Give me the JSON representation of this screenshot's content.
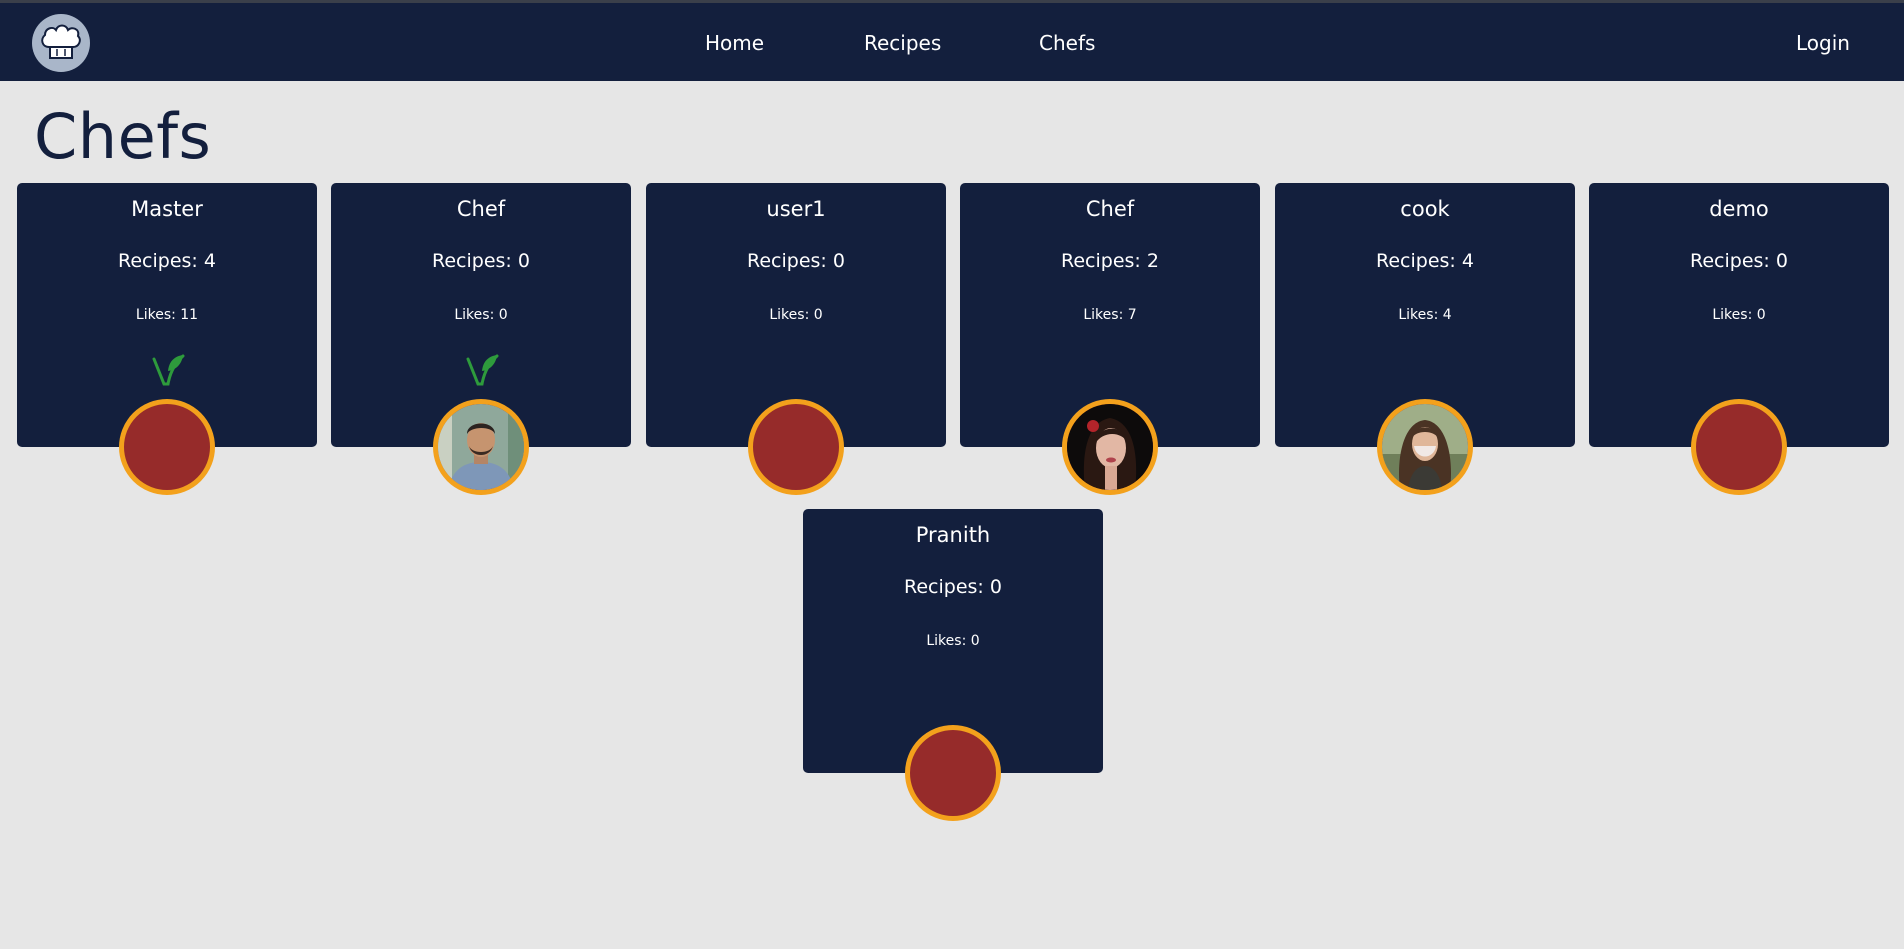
{
  "nav": {
    "logo_icon": "chef-hat-icon",
    "links": [
      "Home",
      "Recipes",
      "Chefs"
    ],
    "login": "Login"
  },
  "page": {
    "title": "Chefs"
  },
  "colors": {
    "navy": "#131f3d",
    "background": "#e6e6e6",
    "avatar_placeholder": "#962b2a",
    "avatar_border": "#f3a11c",
    "veg_icon": "#2e9b3c"
  },
  "chefs": [
    {
      "name": "Master",
      "recipes": "Recipes: 4",
      "likes": "Likes: 11",
      "vegetarian": true,
      "avatar": "placeholder"
    },
    {
      "name": "Chef",
      "recipes": "Recipes: 0",
      "likes": "Likes: 0",
      "vegetarian": true,
      "avatar": "photo-man"
    },
    {
      "name": "user1",
      "recipes": "Recipes: 0",
      "likes": "Likes: 0",
      "vegetarian": false,
      "avatar": "placeholder"
    },
    {
      "name": "Chef",
      "recipes": "Recipes: 2",
      "likes": "Likes: 7",
      "vegetarian": false,
      "avatar": "photo-woman-dark"
    },
    {
      "name": "cook",
      "recipes": "Recipes: 4",
      "likes": "Likes: 4",
      "vegetarian": false,
      "avatar": "photo-woman-mask"
    },
    {
      "name": "demo",
      "recipes": "Recipes: 0",
      "likes": "Likes: 0",
      "vegetarian": false,
      "avatar": "placeholder"
    },
    {
      "name": "Pranith",
      "recipes": "Recipes: 0",
      "likes": "Likes: 0",
      "vegetarian": false,
      "avatar": "placeholder"
    }
  ]
}
